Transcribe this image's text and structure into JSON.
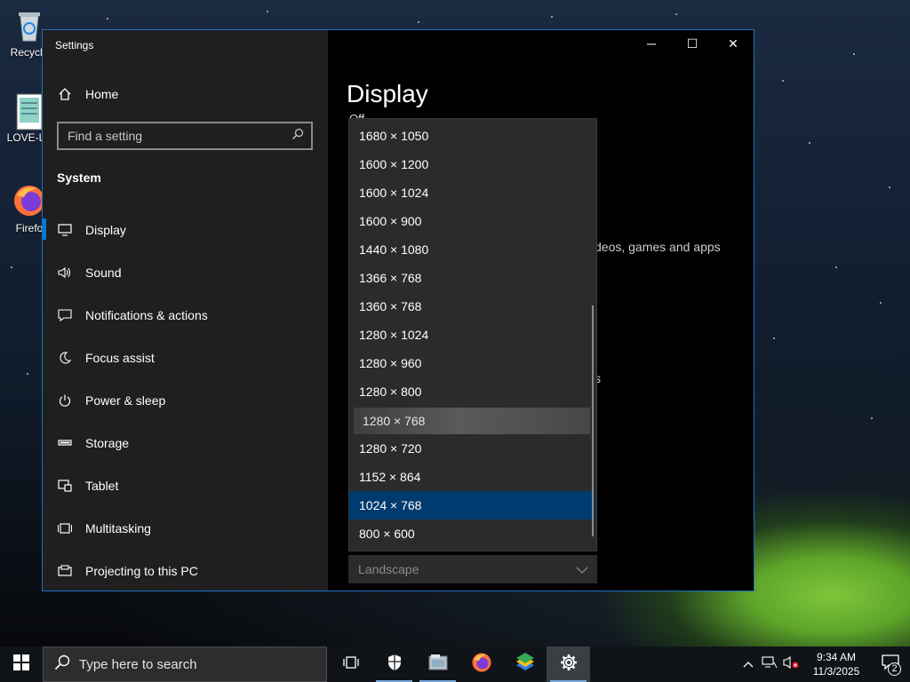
{
  "desktop": {
    "icons": [
      {
        "label": "Recycle",
        "icon": "recycle-bin-icon"
      },
      {
        "label": "LOVE-LE",
        "icon": "notepad-file-icon"
      },
      {
        "label": "Firefo",
        "icon": "firefox-icon"
      }
    ]
  },
  "window": {
    "title": "Settings",
    "controls": {
      "minimize": "─",
      "maximize": "☐",
      "close": "✕"
    }
  },
  "sidebar": {
    "home_label": "Home",
    "search_placeholder": "Find a setting",
    "section": "System",
    "items": [
      {
        "label": "Display",
        "icon": "monitor-icon",
        "active": true
      },
      {
        "label": "Sound",
        "icon": "speaker-icon"
      },
      {
        "label": "Notifications & actions",
        "icon": "notification-icon"
      },
      {
        "label": "Focus assist",
        "icon": "moon-icon"
      },
      {
        "label": "Power & sleep",
        "icon": "power-icon"
      },
      {
        "label": "Storage",
        "icon": "storage-icon"
      },
      {
        "label": "Tablet",
        "icon": "tablet-icon"
      },
      {
        "label": "Multitasking",
        "icon": "multitasking-icon"
      },
      {
        "label": "Projecting to this PC",
        "icon": "projecting-icon"
      }
    ]
  },
  "content": {
    "title": "Display",
    "toggle_peek": "Off",
    "behind_text": "deos, games and apps",
    "behind_s": "s"
  },
  "resolution_dropdown": {
    "options": [
      "1680 × 1050",
      "1600 × 1200",
      "1600 × 1024",
      "1600 × 900",
      "1440 × 1080",
      "1366 × 768",
      "1360 × 768",
      "1280 × 1024",
      "1280 × 960",
      "1280 × 800",
      "1280 × 768",
      "1280 × 720",
      "1152 × 864",
      "1024 × 768",
      "800 × 600"
    ],
    "hovered": "1280 × 768",
    "selected": "1024 × 768"
  },
  "orientation": {
    "value": "Landscape"
  },
  "taskbar": {
    "search_placeholder": "Type here to search",
    "apps": [
      "task-view-icon",
      "security-shield-icon",
      "file-explorer-icon",
      "firefox-icon",
      "bluestacks-icon",
      "settings-gear-icon"
    ],
    "clock_time": "9:34 AM",
    "clock_date": "11/3/2025",
    "notification_count": "2"
  },
  "colors": {
    "accent": "#0078d7",
    "selected_item": "#003b6f",
    "sidebar_bg": "#1f1f1f",
    "dropdown_bg": "#2b2b2b"
  }
}
